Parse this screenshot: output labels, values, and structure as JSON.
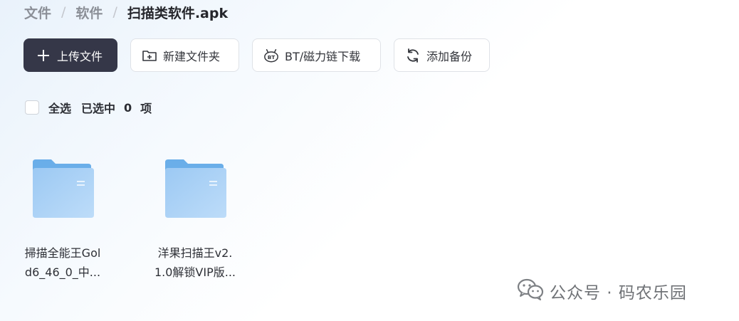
{
  "breadcrumb": {
    "items": [
      "文件",
      "软件"
    ],
    "current": "扫描类软件.apk",
    "separator": "/"
  },
  "toolbar": {
    "upload_label": "上传文件",
    "new_folder_label": "新建文件夹",
    "bt_label": "BT/磁力链下载",
    "backup_label": "添加备份",
    "primary_color": "#353748"
  },
  "selection": {
    "select_all_label": "全选",
    "selected_label": "已选中",
    "count": "0",
    "unit": "项"
  },
  "files": [
    {
      "name": "掃描全能王Gold6_46_0_中...",
      "line1": "掃描全能王Gol",
      "line2": "d6_46_0_中...",
      "icon": "folder-icon"
    },
    {
      "name": "洋果扫描王v2.1.0解锁VIP版...",
      "line1": "洋果扫描王v2.",
      "line2": "1.0解锁VIP版...",
      "icon": "folder-icon"
    }
  ],
  "watermark": {
    "text": "公众号 · 码农乐园",
    "icon": "wechat-icon"
  }
}
